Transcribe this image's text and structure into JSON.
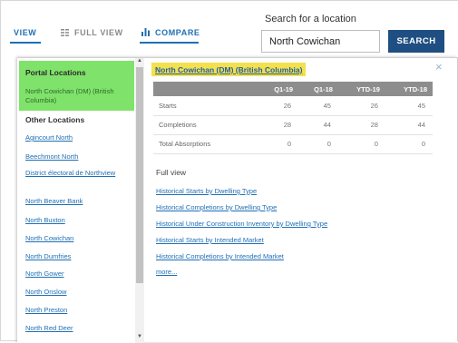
{
  "tabs": {
    "view_label": "VIEW",
    "full_view_label": "FULL VIEW",
    "compare_label": "COMPARE"
  },
  "search": {
    "label": "Search for a location",
    "value": "North Cowichan",
    "button_label": "SEARCH"
  },
  "sidebar": {
    "portal_title": "Portal Locations",
    "portal_item": "North Cowichan (DM) (British Columbia)",
    "other_title": "Other Locations",
    "locations": [
      "Agincourt North",
      "Beechmont North",
      "District électoral de Northview",
      "North Beaver Bank",
      "North Buxton",
      "North Cowichan",
      "North Dumfries",
      "North Gower",
      "North Onslow",
      "North Preston",
      "North Red Deer"
    ]
  },
  "detail": {
    "location_title": "North Cowichan (DM) (British Columbia)",
    "close_symbol": "×",
    "columns": [
      "",
      "Q1-19",
      "Q1-18",
      "YTD-19",
      "YTD-18"
    ],
    "rows": [
      {
        "label": "Starts",
        "values": [
          "26",
          "45",
          "26",
          "45"
        ]
      },
      {
        "label": "Completions",
        "values": [
          "28",
          "44",
          "28",
          "44"
        ]
      },
      {
        "label": "Total Absorptions",
        "values": [
          "0",
          "0",
          "0",
          "0"
        ]
      }
    ],
    "full_view_title": "Full view",
    "links": [
      "Historical Starts by Dwelling Type",
      "Historical Completions by Dwelling Type",
      "Historical Under Construction Inventory by Dwelling Type",
      "Historical Starts by Intended Market",
      "Historical Completions by Intended Market",
      "more..."
    ]
  },
  "colors": {
    "accent": "#1f6fb5",
    "search_button": "#1f4f82",
    "portal_highlight": "#7fe26a",
    "title_highlight": "#f4e04d",
    "table_header": "#8d8d8d"
  }
}
